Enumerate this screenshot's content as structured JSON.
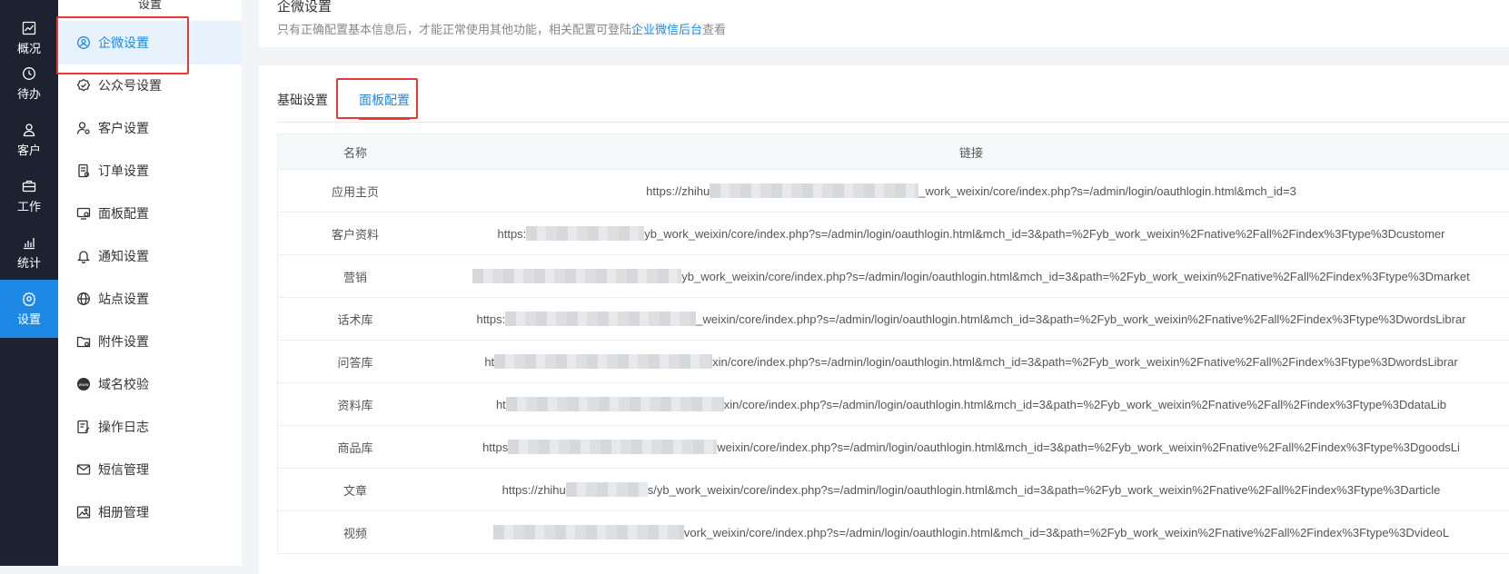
{
  "rail": {
    "items": [
      {
        "label": "概况",
        "icon": "chart-icon"
      },
      {
        "label": "待办",
        "icon": "clock-icon"
      },
      {
        "label": "客户",
        "icon": "user-icon"
      },
      {
        "label": "工作",
        "icon": "briefcase-icon"
      },
      {
        "label": "统计",
        "icon": "bar-chart-icon"
      },
      {
        "label": "设置",
        "icon": "gear-icon",
        "active": true
      }
    ]
  },
  "sidebar": {
    "header": "设置",
    "items": [
      {
        "label": "企微设置",
        "icon": "wecom-icon",
        "active": true
      },
      {
        "label": "公众号设置",
        "icon": "badge-check-icon"
      },
      {
        "label": "客户设置",
        "icon": "user-settings-icon"
      },
      {
        "label": "订单设置",
        "icon": "order-icon"
      },
      {
        "label": "面板配置",
        "icon": "panel-icon"
      },
      {
        "label": "通知设置",
        "icon": "bell-icon"
      },
      {
        "label": "站点设置",
        "icon": "globe-icon"
      },
      {
        "label": "附件设置",
        "icon": "folder-icon"
      },
      {
        "label": "域名校验",
        "icon": "www-icon"
      },
      {
        "label": "操作日志",
        "icon": "log-icon"
      },
      {
        "label": "短信管理",
        "icon": "mail-icon"
      },
      {
        "label": "相册管理",
        "icon": "image-icon"
      }
    ]
  },
  "header": {
    "title": "企微设置",
    "desc_before": "只有正确配置基本信息后，才能正常使用其他功能，相关配置可登陆",
    "desc_link": "企业微信后台",
    "desc_after": "查看"
  },
  "tabs": [
    {
      "label": "基础设置"
    },
    {
      "label": "面板配置",
      "active": true
    }
  ],
  "table": {
    "columns": [
      "名称",
      "链接"
    ],
    "rows": [
      {
        "name": "应用主页",
        "prefix": "https://zhihu",
        "suffix": "_work_weixin/core/index.php?s=/admin/login/oauthlogin.html&mch_id=3"
      },
      {
        "name": "客户资料",
        "prefix": "https:",
        "suffix": "yb_work_weixin/core/index.php?s=/admin/login/oauthlogin.html&mch_id=3&path=%2Fyb_work_weixin%2Fnative%2Fall%2Findex%3Ftype%3Dcustomer"
      },
      {
        "name": "营销",
        "prefix": "",
        "suffix": "yb_work_weixin/core/index.php?s=/admin/login/oauthlogin.html&mch_id=3&path=%2Fyb_work_weixin%2Fnative%2Fall%2Findex%3Ftype%3Dmarket"
      },
      {
        "name": "话术库",
        "prefix": "https:",
        "suffix": "_weixin/core/index.php?s=/admin/login/oauthlogin.html&mch_id=3&path=%2Fyb_work_weixin%2Fnative%2Fall%2Findex%3Ftype%3DwordsLibrar"
      },
      {
        "name": "问答库",
        "prefix": "ht",
        "suffix": "xin/core/index.php?s=/admin/login/oauthlogin.html&mch_id=3&path=%2Fyb_work_weixin%2Fnative%2Fall%2Findex%3Ftype%3DwordsLibrar"
      },
      {
        "name": "资料库",
        "prefix": "ht",
        "suffix": "xin/core/index.php?s=/admin/login/oauthlogin.html&mch_id=3&path=%2Fyb_work_weixin%2Fnative%2Fall%2Findex%3Ftype%3DdataLib"
      },
      {
        "name": "商品库",
        "prefix": "https",
        "suffix": "weixin/core/index.php?s=/admin/login/oauthlogin.html&mch_id=3&path=%2Fyb_work_weixin%2Fnative%2Fall%2Findex%3Ftype%3DgoodsLi"
      },
      {
        "name": "文章",
        "prefix": "https://zhihu",
        "suffix": "s/yb_work_weixin/core/index.php?s=/admin/login/oauthlogin.html&mch_id=3&path=%2Fyb_work_weixin%2Fnative%2Fall%2Findex%3Ftype%3Darticle"
      },
      {
        "name": "视频",
        "prefix": "",
        "suffix": "vork_weixin/core/index.php?s=/admin/login/oauthlogin.html&mch_id=3&path=%2Fyb_work_weixin%2Fnative%2Fall%2Findex%3Ftype%3DvideoL"
      }
    ]
  },
  "colors": {
    "accent": "#1e88e5",
    "rail": "#1c2230",
    "annotation": "#e53935"
  }
}
